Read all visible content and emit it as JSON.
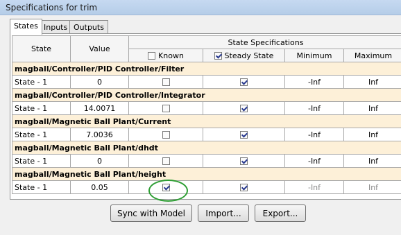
{
  "window": {
    "title": "Specifications for trim"
  },
  "tabs": [
    {
      "label": "States",
      "active": true
    },
    {
      "label": "Inputs",
      "active": false
    },
    {
      "label": "Outputs",
      "active": false
    }
  ],
  "table": {
    "header": {
      "state": "State",
      "value": "Value",
      "group": "State Specifications",
      "known": "Known",
      "known_checked": false,
      "steady": "Steady State",
      "steady_checked": true,
      "minimum": "Minimum",
      "maximum": "Maximum"
    },
    "groups": [
      {
        "name": "magball/Controller/PID Controller/Filter",
        "row": {
          "state": "State - 1",
          "value": "0",
          "known": false,
          "steady": true,
          "min": "-Inf",
          "max": "Inf"
        }
      },
      {
        "name": "magball/Controller/PID Controller/Integrator",
        "row": {
          "state": "State - 1",
          "value": "14.0071",
          "known": false,
          "steady": true,
          "min": "-Inf",
          "max": "Inf"
        }
      },
      {
        "name": "magball/Magnetic Ball Plant/Current",
        "row": {
          "state": "State - 1",
          "value": "7.0036",
          "known": false,
          "steady": true,
          "min": "-Inf",
          "max": "Inf"
        }
      },
      {
        "name": "magball/Magnetic Ball Plant/dhdt",
        "row": {
          "state": "State - 1",
          "value": "0",
          "known": false,
          "steady": true,
          "min": "-Inf",
          "max": "Inf"
        }
      },
      {
        "name": "magball/Magnetic Ball Plant/height",
        "row": {
          "state": "State - 1",
          "value": "0.05",
          "known": true,
          "steady": true,
          "min": "-Inf",
          "max": "Inf"
        }
      }
    ]
  },
  "buttons": {
    "sync": "Sync with Model",
    "import": "Import...",
    "export": "Export..."
  }
}
